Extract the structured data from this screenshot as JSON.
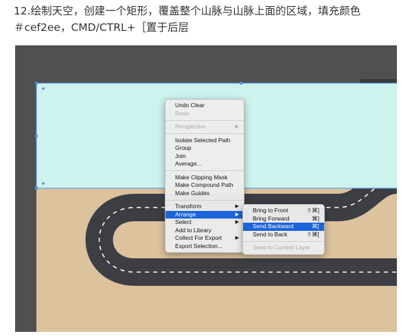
{
  "caption": {
    "line1": "12.绘制天空，创建一个矩形，覆盖整个山脉与山脉上面的区域，填充颜色",
    "line2": "＃cef2ee，CMD/CTRL+［置于后层"
  },
  "colors": {
    "sky": "#cef2ee",
    "sand": "#dcc29d",
    "road": "#3d3d44",
    "canvas_bg": "#505050",
    "highlight": "#1b64d9",
    "selection": "#4a90e2"
  },
  "context_menu": {
    "items": [
      {
        "label": "Undo Clear",
        "enabled": true
      },
      {
        "label": "Redo",
        "enabled": false
      },
      {
        "label": "Perspective",
        "enabled": false,
        "submenu": true
      },
      {
        "label": "Isolate Selected Path",
        "enabled": true
      },
      {
        "label": "Group",
        "enabled": true
      },
      {
        "label": "Join",
        "enabled": true
      },
      {
        "label": "Average...",
        "enabled": true
      },
      {
        "label": "Make Clipping Mask",
        "enabled": true
      },
      {
        "label": "Make Compound Path",
        "enabled": true
      },
      {
        "label": "Make Guides",
        "enabled": true
      },
      {
        "label": "Transform",
        "enabled": true,
        "submenu": true
      },
      {
        "label": "Arrange",
        "enabled": true,
        "submenu": true,
        "highlighted": true
      },
      {
        "label": "Select",
        "enabled": true,
        "submenu": true
      },
      {
        "label": "Add to Library",
        "enabled": true
      },
      {
        "label": "Collect For Export",
        "enabled": true,
        "submenu": true
      },
      {
        "label": "Export Selection...",
        "enabled": true
      }
    ],
    "submenu_arrow": "▶"
  },
  "arrange_submenu": {
    "items": [
      {
        "label": "Bring to Front",
        "shortcut": "⇧⌘]",
        "enabled": true
      },
      {
        "label": "Bring Forward",
        "shortcut": "⌘]",
        "enabled": true
      },
      {
        "label": "Send Backward",
        "shortcut": "⌘[",
        "enabled": true,
        "highlighted": true
      },
      {
        "label": "Send to Back",
        "shortcut": "⇧⌘[",
        "enabled": true
      },
      {
        "label": "Send to Current Layer",
        "enabled": false
      }
    ]
  }
}
